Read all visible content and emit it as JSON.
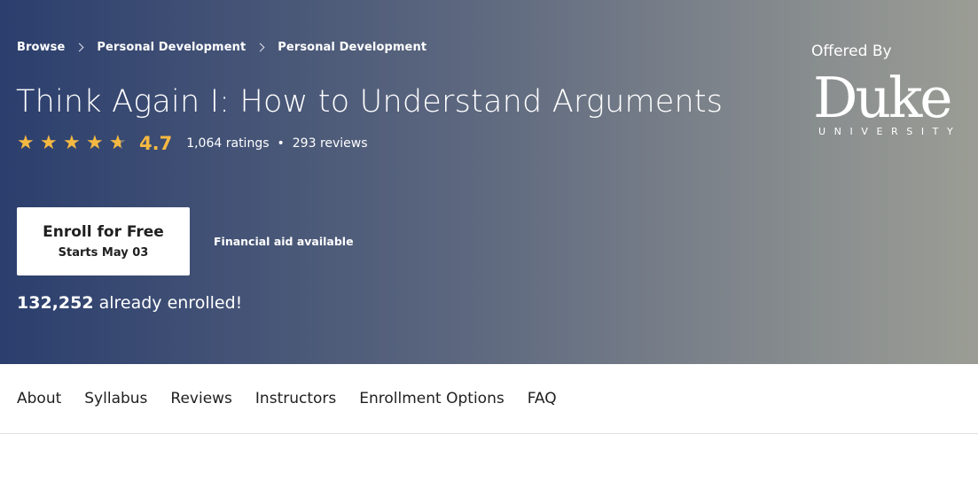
{
  "breadcrumb": [
    {
      "label": "Browse"
    },
    {
      "label": "Personal Development"
    },
    {
      "label": "Personal Development"
    }
  ],
  "course": {
    "title": "Think Again I: How to Understand Arguments",
    "rating": {
      "value": "4.7",
      "stars_out_of_5": 4.7,
      "ratings_count": "1,064 ratings",
      "separator": "•",
      "reviews_count": "293 reviews"
    },
    "enroll_button": {
      "label": "Enroll for Free",
      "sublabel": "Starts May 03"
    },
    "financial_aid": "Financial aid available",
    "enrolled_count": "132,252",
    "enrolled_suffix": " already enrolled!"
  },
  "offered_by": {
    "label": "Offered By",
    "logo_word": "Duke",
    "logo_sub": "UNIVERSITY"
  },
  "tabs": [
    {
      "label": "About"
    },
    {
      "label": "Syllabus"
    },
    {
      "label": "Reviews"
    },
    {
      "label": "Instructors"
    },
    {
      "label": "Enrollment Options"
    },
    {
      "label": "FAQ"
    }
  ],
  "colors": {
    "banner_left": "#2b3e6d",
    "banner_right": "#9b9d95",
    "star": "#f5b942"
  },
  "icons": {
    "star": "★",
    "breadcrumb_separator": "chevron-right-icon"
  }
}
